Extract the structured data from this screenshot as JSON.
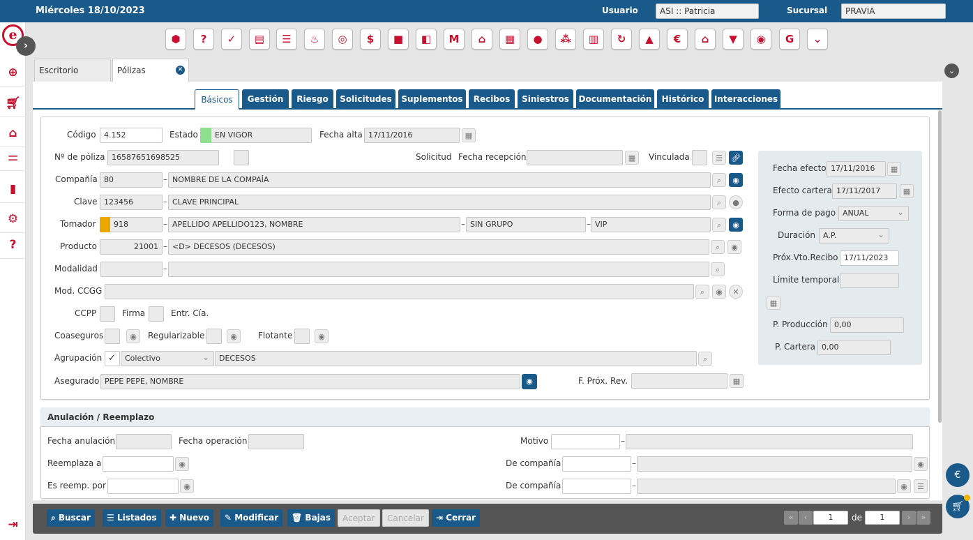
{
  "header": {
    "date": "Miércoles 18/10/2023",
    "user_label": "Usuario",
    "user_value": "ASI :: Patricia",
    "branch_label": "Sucursal",
    "branch_value": "PRAVIA"
  },
  "sidebar": {
    "logo": "e",
    "items": [
      "plus-circle-icon",
      "cart-icon",
      "house-doc-icon",
      "sliders-icon",
      "bar-chart-icon",
      "gear-icon",
      "help-icon",
      "logout-icon"
    ]
  },
  "toolbar_icons": [
    "cube-icon",
    "person-question-icon",
    "person-check-icon",
    "document-icon",
    "list-doc-icon",
    "flame-icon",
    "target-icon",
    "money-icon",
    "briefcase-icon",
    "shopping-bag-icon",
    "m-logo-icon",
    "house-icon",
    "building-icon",
    "person-icon",
    "group-icon",
    "building-plus-icon",
    "refresh-icon",
    "people-money-icon",
    "euro-icon",
    "house-euro-icon",
    "shield-euro-icon",
    "eye-logo-icon",
    "g-logo-icon",
    "chevron-down-icon"
  ],
  "doc_tabs": {
    "desktop": "Escritorio",
    "policies": "Pólizas"
  },
  "tabs": [
    "Básicos",
    "Gestión",
    "Riesgo",
    "Solicitudes",
    "Suplementos",
    "Recibos",
    "Siniestros",
    "Documentación",
    "Histórico",
    "Interacciones"
  ],
  "form": {
    "codigo_label": "Código",
    "codigo": "4.152",
    "estado_label": "Estado",
    "estado": "EN VIGOR",
    "estado_color": "#8ee08e",
    "fecha_alta_label": "Fecha alta",
    "fecha_alta": "17/11/2016",
    "poliza_label": "Nº de póliza",
    "poliza": "16587651698525",
    "solicitud_label": "Solicitud",
    "fecha_recepcion_label": "Fecha recepción",
    "vinculada_label": "Vinculada",
    "compania_label": "Compañía",
    "compania_code": "80",
    "compania_name": "NOMBRE DE LA COMPAÍA",
    "clave_label": "Clave",
    "clave_code": "123456",
    "clave_name": "CLAVE PRINCIPAL",
    "tomador_label": "Tomador",
    "tomador_code": "918",
    "tomador_color": "#e8a800",
    "tomador_name": "APELLIDO APELLIDO123, NOMBRE",
    "grupo": "SIN GRUPO",
    "categoria": "VIP",
    "producto_label": "Producto",
    "producto_code": "21001",
    "producto_name": "<D> DECESOS (DECESOS)",
    "modalidad_label": "Modalidad",
    "modccgg_label": "Mod. CCGG",
    "ccpp_label": "CCPP",
    "firma_label": "Firma",
    "entr_label": "Entr. Cía.",
    "coaseguros_label": "Coaseguros",
    "regularizable_label": "Regularizable",
    "flotante_label": "Flotante",
    "agrupacion_label": "Agrupación",
    "agrupacion_tipo": "Colectivo",
    "agrupacion_name": "DECESOS",
    "asegurado_label": "Asegurado",
    "asegurado": "PEPE PEPE, NOMBRE",
    "fprox_label": "F. Próx. Rev."
  },
  "side": {
    "fecha_efecto_label": "Fecha efecto",
    "fecha_efecto": "17/11/2016",
    "efecto_cartera_label": "Efecto cartera",
    "efecto_cartera": "17/11/2017",
    "forma_pago_label": "Forma de pago",
    "forma_pago": "ANUAL",
    "duracion_label": "Duración",
    "duracion": "A.P.",
    "prox_vto_label": "Próx.Vto.Recibo",
    "prox_vto": "17/11/2023",
    "limite_label": "Límite temporal",
    "p_produccion_label": "P. Producción",
    "p_produccion": "0,00",
    "p_cartera_label": "P. Cartera",
    "p_cartera": "0,00"
  },
  "anulacion": {
    "title": "Anulación / Reemplazo",
    "fecha_anulacion_label": "Fecha anulación",
    "fecha_operacion_label": "Fecha operación",
    "motivo_label": "Motivo",
    "reemplaza_label": "Reemplaza a",
    "de_compania_label": "De compañía",
    "es_reemp_label": "Es reemp. por",
    "de_compania2_label": "De compañía"
  },
  "actions": {
    "buscar": "Buscar",
    "listados": "Listados",
    "nuevo": "Nuevo",
    "modificar": "Modificar",
    "bajas": "Bajas",
    "aceptar": "Aceptar",
    "cancelar": "Cancelar",
    "cerrar": "Cerrar"
  },
  "pagination": {
    "page": "1",
    "of_label": "de",
    "total": "1"
  }
}
